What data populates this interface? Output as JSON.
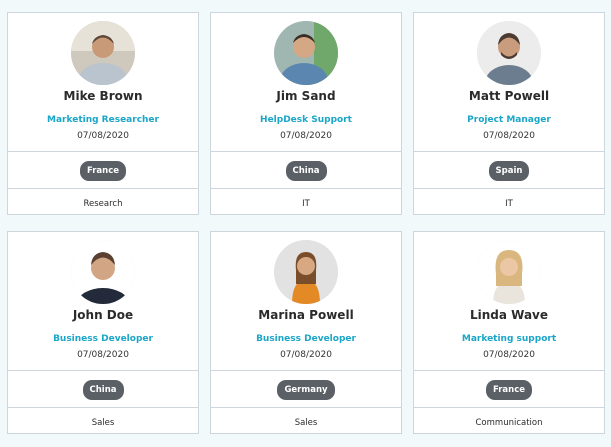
{
  "cards": [
    {
      "name": "Mike Brown",
      "role": "Marketing Researcher",
      "date": "07/08/2020",
      "country": "France",
      "department": "Research"
    },
    {
      "name": "Jim Sand",
      "role": "HelpDesk Support",
      "date": "07/08/2020",
      "country": "China",
      "department": "IT"
    },
    {
      "name": "Matt Powell",
      "role": "Project Manager",
      "date": "07/08/2020",
      "country": "Spain",
      "department": "IT"
    },
    {
      "name": "John Doe",
      "role": "Business Developer",
      "date": "07/08/2020",
      "country": "China",
      "department": "Sales"
    },
    {
      "name": "Marina Powell",
      "role": "Business Developer",
      "date": "07/08/2020",
      "country": "Germany",
      "department": "Sales"
    },
    {
      "name": "Linda Wave",
      "role": "Marketing support",
      "date": "07/08/2020",
      "country": "France",
      "department": "Communication"
    }
  ],
  "colors": {
    "background": "#f1f9fb",
    "role_accent": "#1aa6c8",
    "badge_bg": "#5b6066",
    "border": "#cdd6dc"
  }
}
